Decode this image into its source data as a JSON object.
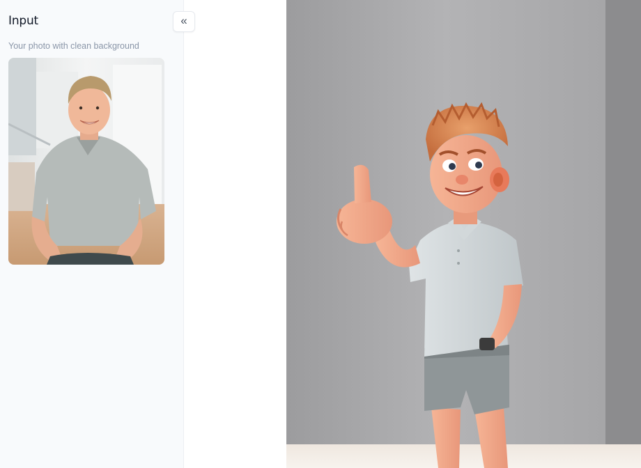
{
  "input_panel": {
    "title": "Input",
    "subtitle": "Your photo with clean background",
    "collapse_icon": "double-chevron-left-icon",
    "collapse_glyph": "«",
    "photo_icon": "person-photo"
  },
  "output_panel": {
    "image_icon": "cartoon-character-thumbs-up"
  },
  "colors": {
    "panel_bg": "#f8fafc",
    "subtitle": "#8a96a8",
    "wall": "#a9a9ab",
    "floor": "#efe9e3",
    "shirt": "#c9cfd1",
    "shorts": "#8e9597",
    "hair": "#d8834f",
    "skin": "#f1a887"
  }
}
